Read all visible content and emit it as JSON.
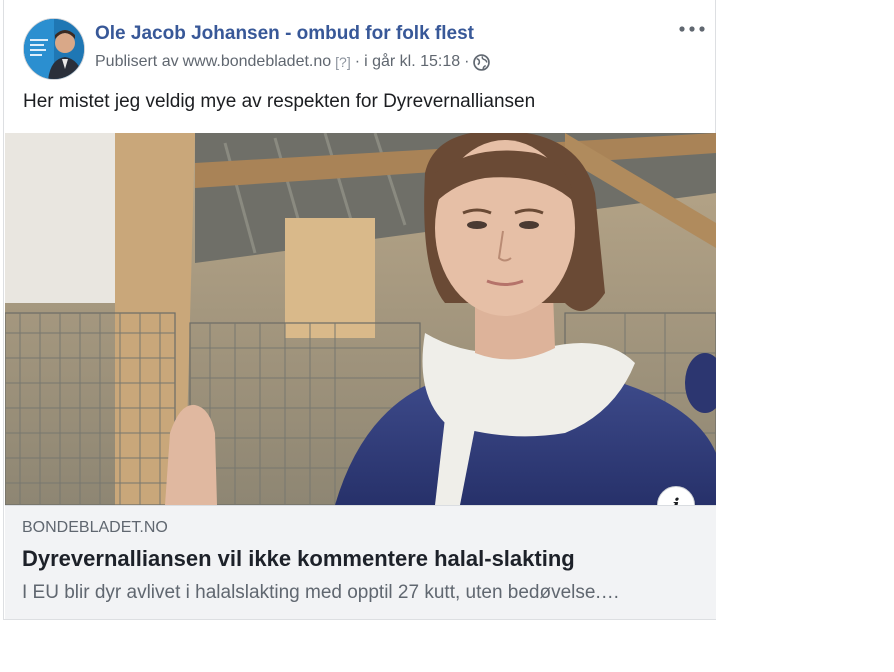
{
  "post": {
    "author": "Ole Jacob Johansen - ombud for folk flest",
    "published_prefix": "Publisert av",
    "published_site": "www.bondebladet.no",
    "help_marker": "[?]",
    "sep1": "·",
    "timestamp": "i går kl. 15:18",
    "sep2": "·",
    "text": "Her mistet jeg veldig mye av respekten for Dyrevernalliansen",
    "more_label": "•••"
  },
  "link_preview": {
    "domain": "BONDEBLADET.NO",
    "headline": "Dyrevernalliansen vil ikke kommentere halal-slakting",
    "description": "I EU blir dyr avlivet i halalslakting med opptil 27 kutt, uten bedøvelse.…",
    "info_label": "i"
  },
  "icons": {
    "audience": "globe-icon",
    "more": "more-options-icon",
    "info": "info-icon"
  },
  "colors": {
    "author_link": "#385898",
    "secondary_text": "#606770",
    "link_box_bg": "#f2f3f5"
  }
}
